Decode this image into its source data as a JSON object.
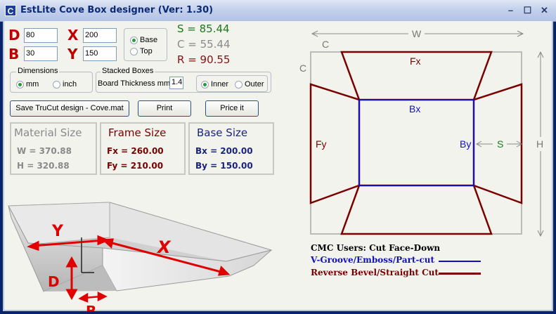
{
  "window": {
    "title": "EstLite Cove Box designer (Ver: 1.30)",
    "app_icon_letter": "C",
    "controls": [
      "–",
      "☐",
      "✕"
    ]
  },
  "inputs": {
    "D": {
      "label": "D",
      "value": "80"
    },
    "B": {
      "label": "B",
      "value": "30"
    },
    "X": {
      "label": "X",
      "value": "200"
    },
    "Y": {
      "label": "Y",
      "value": "150"
    },
    "board_thickness": {
      "label": "Board Thickness mm",
      "value": "1.4"
    }
  },
  "base_top": {
    "base": "Base",
    "top": "Top",
    "selected": "base"
  },
  "stats": {
    "S": "S = 85.44",
    "C": "C = 55.44",
    "R": "R = 90.55"
  },
  "dimensions": {
    "title": "Dimensions",
    "mm": "mm",
    "inch": "inch",
    "selected": "mm"
  },
  "stacked": {
    "title": "Stacked Boxes",
    "inner": "Inner",
    "outer": "Outer",
    "selected": "inner"
  },
  "buttons": {
    "save": "Save TruCut design - Cove.mat",
    "print": "Print",
    "price": "Price it"
  },
  "material": {
    "title": "Material Size",
    "w": "W = 370.88",
    "h": "H = 320.88"
  },
  "frame": {
    "title": "Frame Size",
    "fx": "Fx = 260.00",
    "fy": "Fy = 210.00"
  },
  "base": {
    "title": "Base Size",
    "bx": "Bx = 200.00",
    "by": "By = 150.00"
  },
  "illustration": {
    "y": "Y",
    "x": "X",
    "d": "D",
    "b": "B"
  },
  "diagram": {
    "w": "W",
    "h": "H",
    "c_top": "C",
    "c_left": "C",
    "fx": "Fx",
    "fy": "Fy",
    "bx": "Bx",
    "by": "By",
    "s": "S"
  },
  "legend": {
    "title": "CMC Users: Cut Face-Down",
    "vgroove": "V-Groove/Emboss/Part-cut",
    "bevel": "Reverse Bevel/Straight Cut",
    "vgroove_color": "#1010c0",
    "bevel_color": "#7a0000"
  },
  "colors": {
    "accent_red": "#c00000",
    "green": "#1a7a1a",
    "grey": "#8a8a8a",
    "darkred": "#7a0000",
    "navy": "#1a237e"
  }
}
